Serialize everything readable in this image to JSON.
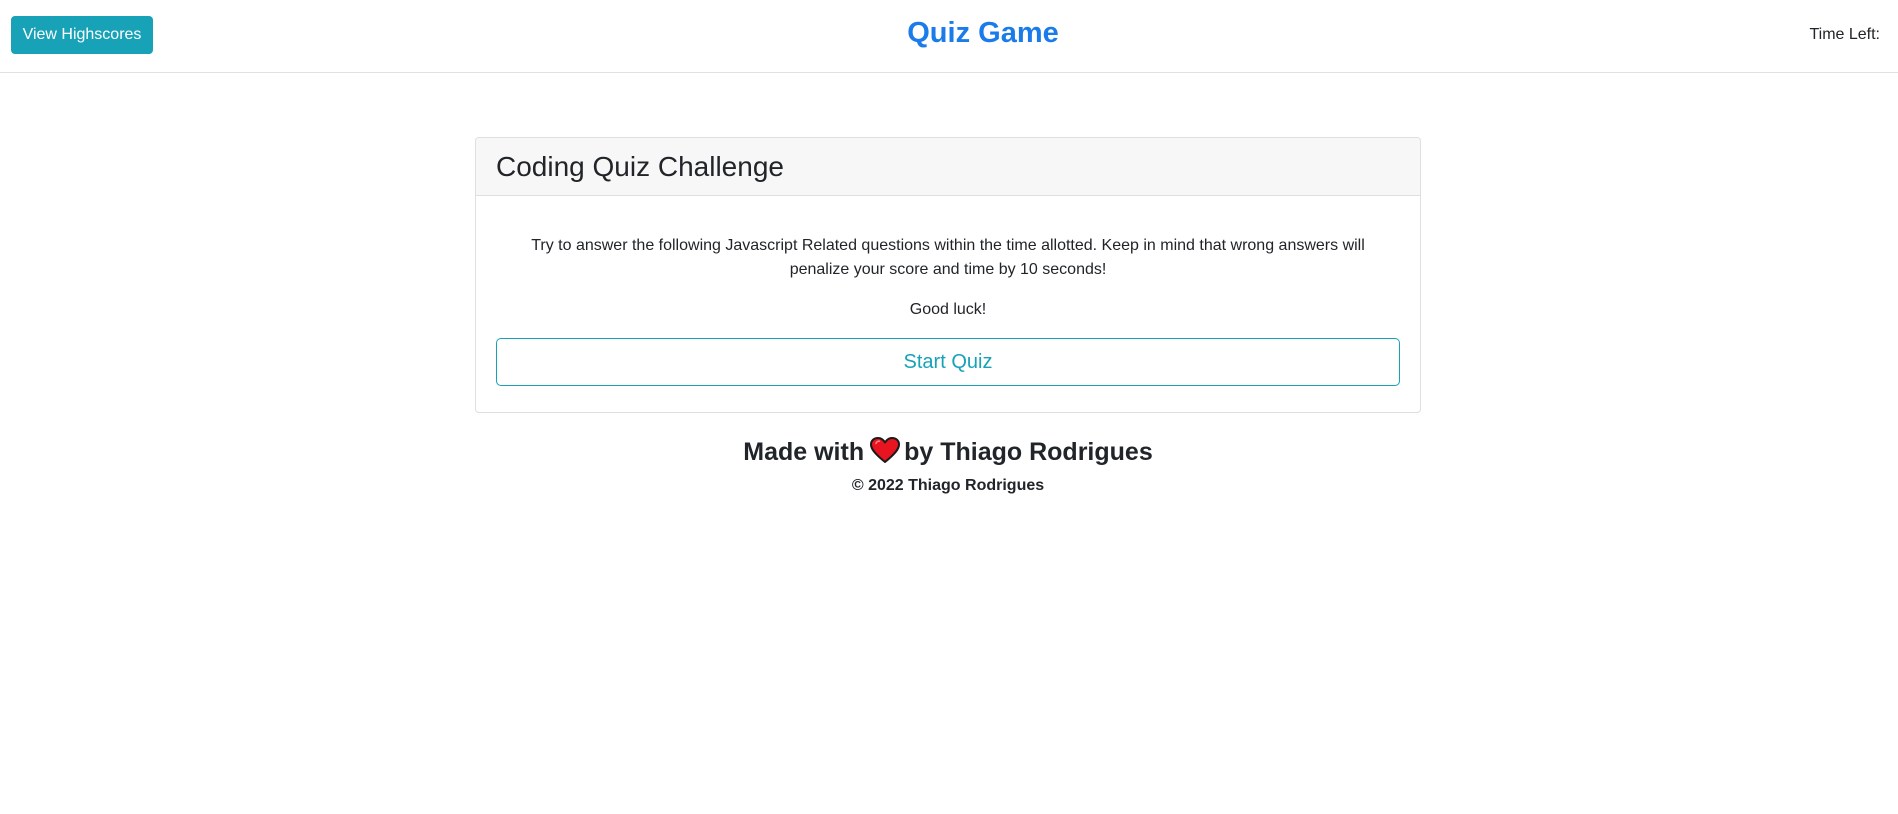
{
  "header": {
    "highscores_label": "View Highscores",
    "title": "Quiz Game",
    "timer_label": "Time Left:",
    "timer_value": ""
  },
  "card": {
    "title": "Coding Quiz Challenge",
    "description": "Try to answer the following Javascript Related questions within the time allotted. Keep in mind that wrong answers will penalize your score and time by 10 seconds!",
    "good_luck": "Good luck!",
    "start_label": "Start Quiz"
  },
  "footer": {
    "made_prefix": "Made with",
    "made_suffix": "by Thiago Rodrigues",
    "heart_icon": "heart-icon",
    "copyright": "© 2022 Thiago Rodrigues"
  },
  "colors": {
    "accent": "#17a2b8",
    "title": "#1a7bea",
    "heart": "#e8141f"
  }
}
